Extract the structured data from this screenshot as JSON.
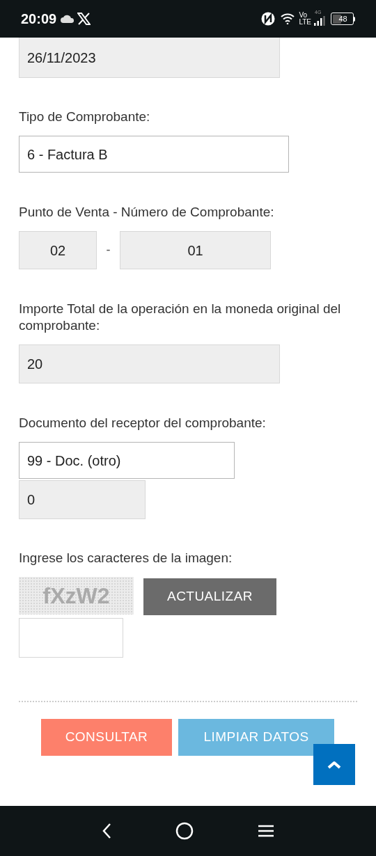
{
  "status_bar": {
    "time": "20:09",
    "network": "4G",
    "volte_top": "Vo",
    "volte_bottom": "LTE",
    "battery": "48"
  },
  "sections": [
    {
      "fields": [
        {
          "kind": "readonly",
          "value": "26/11/2023"
        }
      ]
    },
    {
      "label": "Tipo de Comprobante:",
      "fields": [
        {
          "kind": "select",
          "value": "6 - Factura B"
        }
      ]
    },
    {
      "label": "Punto de Venta - Número de Comprobante:",
      "separator": "-",
      "fields": [
        {
          "kind": "readonly",
          "value": "02"
        },
        {
          "kind": "readonly",
          "value": "01"
        }
      ]
    },
    {
      "label": "Importe Total de la operación en la moneda original del comprobante:",
      "fields": [
        {
          "kind": "readonly",
          "value": "20"
        }
      ]
    },
    {
      "label": "Documento del receptor del comprobante:",
      "fields": [
        {
          "kind": "select",
          "value": "99 - Doc. (otro)"
        },
        {
          "kind": "readonly",
          "value": "0"
        }
      ]
    }
  ],
  "captcha": {
    "label": "Ingrese los caracteres de la imagen:",
    "image_text": "fXzW2",
    "refresh_button": "ACTUALIZAR"
  },
  "actions": [
    {
      "kind": "primary",
      "label": "CONSULTAR"
    },
    {
      "kind": "secondary",
      "label": "LIMPIAR DATOS"
    }
  ]
}
